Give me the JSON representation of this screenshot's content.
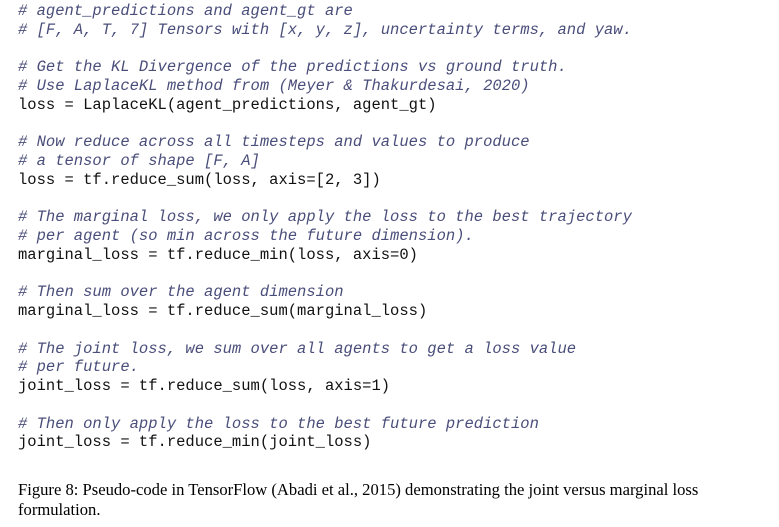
{
  "code_lines": [
    {
      "kind": "comment",
      "text": "# agent_predictions and agent_gt are"
    },
    {
      "kind": "comment",
      "text": "# [F, A, T, 7] Tensors with [x, y, z], uncertainty terms, and yaw."
    },
    {
      "kind": "blank",
      "text": ""
    },
    {
      "kind": "comment",
      "text": "# Get the KL Divergence of the predictions vs ground truth."
    },
    {
      "kind": "comment",
      "text": "# Use LaplaceKL method from (Meyer & Thakurdesai, 2020)"
    },
    {
      "kind": "code",
      "text": "loss = LaplaceKL(agent_predictions, agent_gt)"
    },
    {
      "kind": "blank",
      "text": ""
    },
    {
      "kind": "comment",
      "text": "# Now reduce across all timesteps and values to produce"
    },
    {
      "kind": "comment",
      "text": "# a tensor of shape [F, A]"
    },
    {
      "kind": "code",
      "text": "loss = tf.reduce_sum(loss, axis=[2, 3])"
    },
    {
      "kind": "blank",
      "text": ""
    },
    {
      "kind": "comment",
      "text": "# The marginal loss, we only apply the loss to the best trajectory"
    },
    {
      "kind": "comment",
      "text": "# per agent (so min across the future dimension)."
    },
    {
      "kind": "code",
      "text": "marginal_loss = tf.reduce_min(loss, axis=0)"
    },
    {
      "kind": "blank",
      "text": ""
    },
    {
      "kind": "comment",
      "text": "# Then sum over the agent dimension"
    },
    {
      "kind": "code",
      "text": "marginal_loss = tf.reduce_sum(marginal_loss)"
    },
    {
      "kind": "blank",
      "text": ""
    },
    {
      "kind": "comment",
      "text": "# The joint loss, we sum over all agents to get a loss value"
    },
    {
      "kind": "comment",
      "text": "# per future."
    },
    {
      "kind": "code",
      "text": "joint_loss = tf.reduce_sum(loss, axis=1)"
    },
    {
      "kind": "blank",
      "text": ""
    },
    {
      "kind": "comment",
      "text": "# Then only apply the loss to the best future prediction"
    },
    {
      "kind": "code",
      "text": "joint_loss = tf.reduce_min(joint_loss)"
    }
  ],
  "caption": "Figure 8: Pseudo-code in TensorFlow (Abadi et al., 2015) demonstrating the joint versus marginal loss formulation."
}
